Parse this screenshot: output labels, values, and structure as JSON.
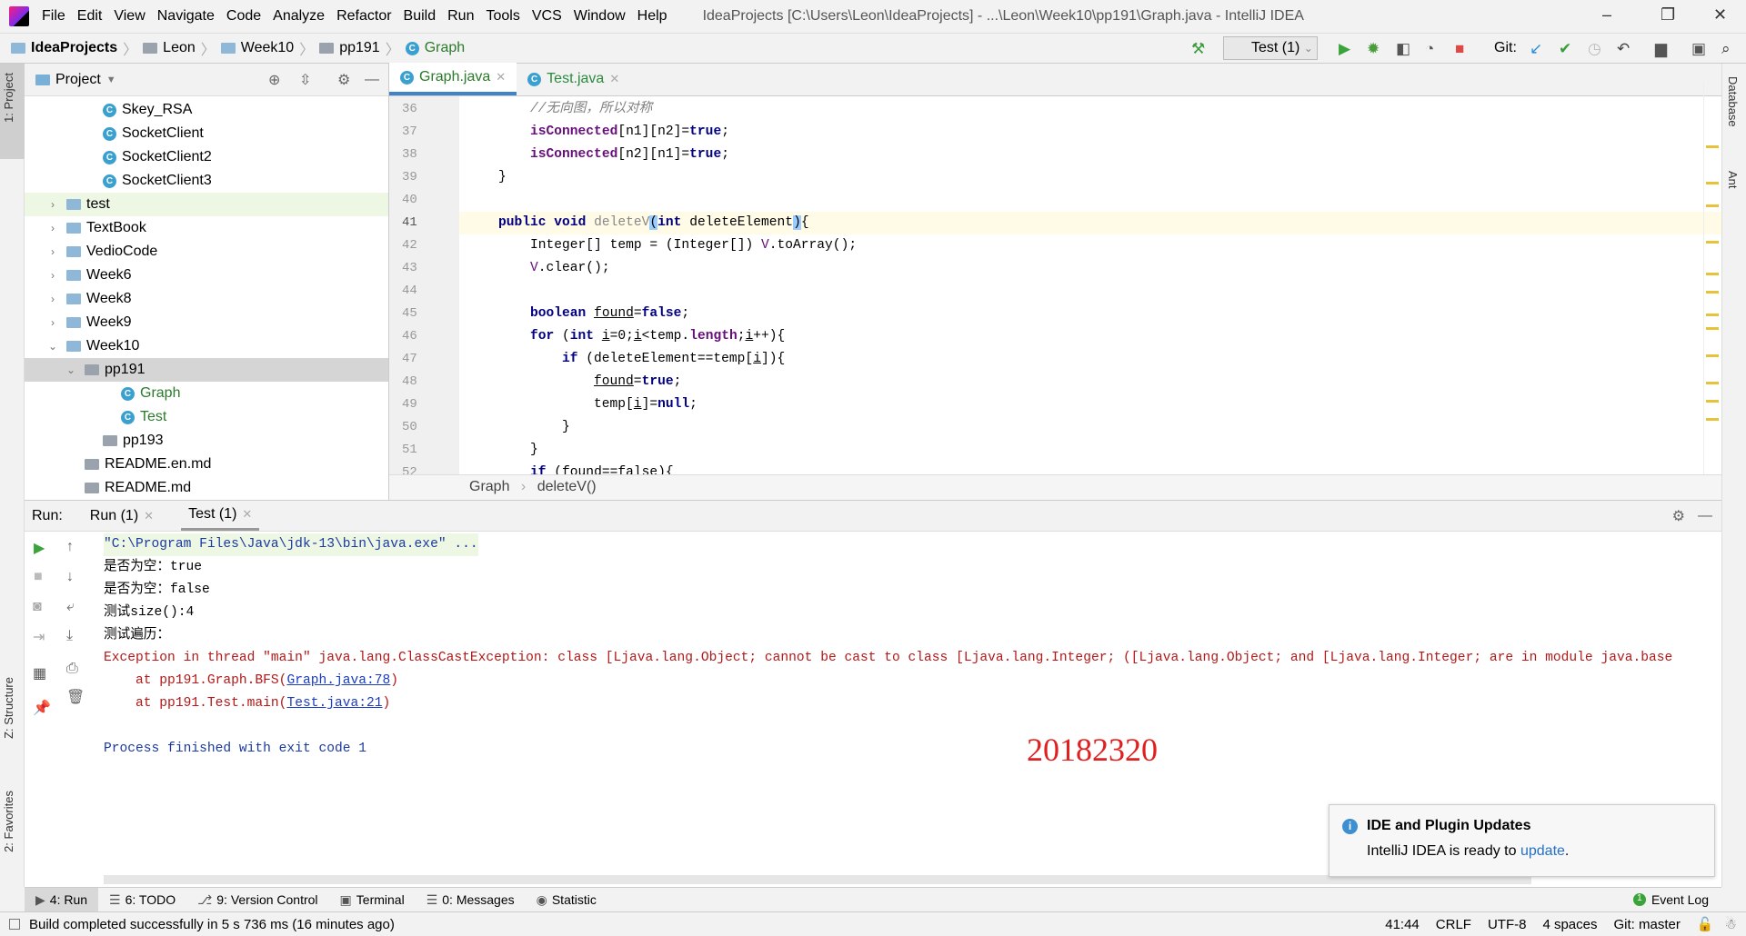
{
  "menu": {
    "items": [
      "File",
      "Edit",
      "View",
      "Navigate",
      "Code",
      "Analyze",
      "Refactor",
      "Build",
      "Run",
      "Tools",
      "VCS",
      "Window",
      "Help"
    ],
    "title": "IdeaProjects [C:\\Users\\Leon\\IdeaProjects] - ...\\Leon\\Week10\\pp191\\Graph.java - IntelliJ IDEA"
  },
  "breadcrumb": [
    "IdeaProjects",
    "Leon",
    "Week10",
    "pp191",
    "Graph"
  ],
  "toolbar": {
    "run_config": "Test (1)",
    "git_label": "Git:"
  },
  "left_strip": {
    "project": "1: Project",
    "structure": "Z: Structure",
    "favorites": "2: Favorites"
  },
  "right_strip": {
    "database": "Database",
    "ant": "Ant"
  },
  "project": {
    "title": "Project",
    "tree": [
      {
        "label": "Skey_RSA",
        "type": "class",
        "depth": 4
      },
      {
        "label": "SocketClient",
        "type": "class",
        "depth": 4
      },
      {
        "label": "SocketClient2",
        "type": "class",
        "depth": 4
      },
      {
        "label": "SocketClient3",
        "type": "class",
        "depth": 4
      },
      {
        "label": "test",
        "type": "folder",
        "depth": 2,
        "arrow": "›",
        "hl": true
      },
      {
        "label": "TextBook",
        "type": "folder",
        "depth": 2,
        "arrow": "›"
      },
      {
        "label": "VedioCode",
        "type": "folder",
        "depth": 2,
        "arrow": "›"
      },
      {
        "label": "Week6",
        "type": "folder",
        "depth": 2,
        "arrow": "›"
      },
      {
        "label": "Week8",
        "type": "folder",
        "depth": 2,
        "arrow": "›"
      },
      {
        "label": "Week9",
        "type": "folder",
        "depth": 2,
        "arrow": "›"
      },
      {
        "label": "Week10",
        "type": "folder",
        "depth": 2,
        "arrow": "⌄"
      },
      {
        "label": "pp191",
        "type": "package",
        "depth": 3,
        "arrow": "⌄",
        "sel": true
      },
      {
        "label": "Graph",
        "type": "class",
        "depth": 5
      },
      {
        "label": "Test",
        "type": "class",
        "depth": 5
      },
      {
        "label": "pp193",
        "type": "package",
        "depth": 4
      },
      {
        "label": "README.en.md",
        "type": "md",
        "depth": 3
      },
      {
        "label": "README.md",
        "type": "md",
        "depth": 3
      }
    ]
  },
  "editor": {
    "tabs": [
      {
        "label": "Graph.java",
        "active": true
      },
      {
        "label": "Test.java",
        "active": false
      }
    ],
    "lines": [
      {
        "n": "36",
        "indent": 2,
        "seg": [
          [
            "//无向图，所以对称",
            "cm"
          ]
        ]
      },
      {
        "n": "37",
        "indent": 2,
        "seg": [
          [
            "isConnected",
            "fld"
          ],
          [
            "[n1][n2]=",
            ""
          ],
          [
            "true",
            "kw"
          ],
          [
            ";",
            ""
          ]
        ]
      },
      {
        "n": "38",
        "indent": 2,
        "seg": [
          [
            "isConnected",
            "fld"
          ],
          [
            "[n2][n1]=",
            ""
          ],
          [
            "true",
            "kw"
          ],
          [
            ";",
            ""
          ]
        ]
      },
      {
        "n": "39",
        "indent": 1,
        "seg": [
          [
            "}",
            ""
          ]
        ]
      },
      {
        "n": "40",
        "indent": 0,
        "seg": []
      },
      {
        "n": "41",
        "indent": 1,
        "cur": true,
        "seg": [
          [
            "public void ",
            "kw"
          ],
          [
            "deleteV",
            "gray"
          ],
          [
            "(",
            "brk"
          ],
          [
            "int ",
            "kw"
          ],
          [
            "deleteElement",
            ""
          ],
          [
            ")",
            "brk"
          ],
          [
            "{",
            ""
          ]
        ]
      },
      {
        "n": "42",
        "indent": 2,
        "seg": [
          [
            "Integer[] temp = (Integer[]) ",
            ""
          ],
          [
            "V",
            "stat"
          ],
          [
            ".toArray();",
            ""
          ]
        ]
      },
      {
        "n": "43",
        "indent": 2,
        "seg": [
          [
            "V",
            "stat"
          ],
          [
            ".clear();",
            ""
          ]
        ]
      },
      {
        "n": "44",
        "indent": 0,
        "seg": []
      },
      {
        "n": "45",
        "indent": 2,
        "seg": [
          [
            "boolean ",
            "kw"
          ],
          [
            "found",
            "ul"
          ],
          [
            "=",
            ""
          ],
          [
            "false",
            "kw"
          ],
          [
            ";",
            ""
          ]
        ]
      },
      {
        "n": "46",
        "indent": 2,
        "seg": [
          [
            "for ",
            "kw"
          ],
          [
            "(",
            ""
          ],
          [
            "int ",
            "kw"
          ],
          [
            "i",
            "ul"
          ],
          [
            "=0;",
            ""
          ],
          [
            "i",
            "ul"
          ],
          [
            "<temp.",
            ""
          ],
          [
            "length",
            "fld"
          ],
          [
            ";",
            ""
          ],
          [
            "i",
            "ul"
          ],
          [
            "++){",
            ""
          ]
        ]
      },
      {
        "n": "47",
        "indent": 3,
        "seg": [
          [
            "if ",
            "kw"
          ],
          [
            "(deleteElement==temp[",
            ""
          ],
          [
            "i",
            "ul"
          ],
          [
            "]){",
            ""
          ]
        ]
      },
      {
        "n": "48",
        "indent": 4,
        "seg": [
          [
            "found",
            "ul"
          ],
          [
            "=",
            ""
          ],
          [
            "true",
            "kw"
          ],
          [
            ";",
            ""
          ]
        ]
      },
      {
        "n": "49",
        "indent": 4,
        "seg": [
          [
            "temp[",
            ""
          ],
          [
            "i",
            "ul"
          ],
          [
            "]=",
            ""
          ],
          [
            "null",
            "kw"
          ],
          [
            ";",
            ""
          ]
        ]
      },
      {
        "n": "50",
        "indent": 3,
        "seg": [
          [
            "}",
            ""
          ]
        ]
      },
      {
        "n": "51",
        "indent": 2,
        "seg": [
          [
            "}",
            ""
          ]
        ]
      },
      {
        "n": "52",
        "indent": 2,
        "seg": [
          [
            "if ",
            "kw"
          ],
          [
            "(found==false){",
            ""
          ]
        ]
      }
    ],
    "breadcrumb": [
      "Graph",
      "deleteV()"
    ]
  },
  "run": {
    "label": "Run:",
    "tabs": [
      {
        "label": "Run (1)"
      },
      {
        "label": "Test (1)",
        "active": true
      }
    ],
    "console": [
      {
        "text": "\"C:\\Program Files\\Java\\jdk-13\\bin\\java.exe\" ...",
        "cls": "blue"
      },
      {
        "text": "是否为空：true",
        "cls": ""
      },
      {
        "text": "是否为空：false",
        "cls": ""
      },
      {
        "text": "测试size():4",
        "cls": ""
      },
      {
        "text": "测试遍历：",
        "cls": ""
      },
      {
        "text": "Exception in thread \"main\" java.lang.ClassCastException: class [Ljava.lang.Object; cannot be cast to class [Ljava.lang.Integer; ([Ljava.lang.Object; and [Ljava.lang.Integer; are in module java.base",
        "cls": "err"
      },
      {
        "pre": "    at pp191.Graph.BFS(",
        "link": "Graph.java:78",
        "post": ")",
        "cls": "err"
      },
      {
        "pre": "    at pp191.Test.main(",
        "link": "Test.java:21",
        "post": ")",
        "cls": "err"
      },
      {
        "text": "",
        "cls": ""
      },
      {
        "text": "Process finished with exit code 1",
        "cls": "blue"
      }
    ],
    "watermark": "20182320"
  },
  "notification": {
    "title": "IDE and Plugin Updates",
    "body": "IntelliJ IDEA is ready to ",
    "link": "update",
    "end": "."
  },
  "tool_windows": [
    "4: Run",
    "6: TODO",
    "9: Version Control",
    "Terminal",
    "0: Messages",
    "Statistic"
  ],
  "event_log": "Event Log",
  "status": {
    "message": "Build completed successfully in 5 s 736 ms (16 minutes ago)",
    "position": "41:44",
    "line_sep": "CRLF",
    "encoding": "UTF-8",
    "indent": "4 spaces",
    "git": "Git: master"
  },
  "colors": {
    "accent": "#4083c9",
    "error": "#b41818",
    "link": "#1a3cbf",
    "watermark": "#e02020"
  }
}
